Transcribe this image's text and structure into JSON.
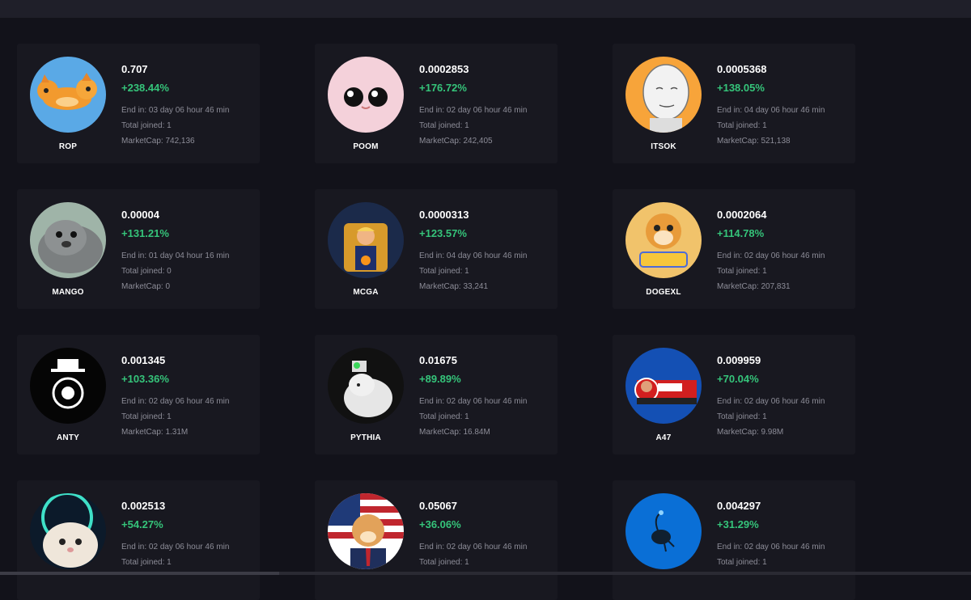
{
  "tokens": [
    {
      "ticker": "ROP",
      "price": "0.707",
      "change": "+238.44%",
      "end_in": "End in: 03 day 06 hour 46 min",
      "joined": "Total joined: 1",
      "marketcap": "MarketCap: 742,136",
      "icon": "orange-cat-icon"
    },
    {
      "ticker": "POOM",
      "price": "0.0002853",
      "change": "+176.72%",
      "end_in": "End in: 02 day 06 hour 46 min",
      "joined": "Total joined: 1",
      "marketcap": "MarketCap: 242,405",
      "icon": "pink-face-icon"
    },
    {
      "ticker": "ITSOK",
      "price": "0.0005368",
      "change": "+138.05%",
      "end_in": "End in: 04 day 06 hour 46 min",
      "joined": "Total joined: 1",
      "marketcap": "MarketCap: 521,138",
      "icon": "wojak-face-icon"
    },
    {
      "ticker": "MANGO",
      "price": "0.00004",
      "change": "+131.21%",
      "end_in": "End in: 01 day 04 hour 16 min",
      "joined": "Total joined: 0",
      "marketcap": "MarketCap: 0",
      "icon": "seal-icon"
    },
    {
      "ticker": "MCGA",
      "price": "0.0000313",
      "change": "+123.57%",
      "end_in": "End in: 04 day 06 hour 46 min",
      "joined": "Total joined: 1",
      "marketcap": "MarketCap: 33,241",
      "icon": "throne-man-icon"
    },
    {
      "ticker": "DOGEXL",
      "price": "0.0002064",
      "change": "+114.78%",
      "end_in": "End in: 02 day 06 hour 46 min",
      "joined": "Total joined: 1",
      "marketcap": "MarketCap: 207,831",
      "icon": "doge-xl-icon"
    },
    {
      "ticker": "ANTY",
      "price": "0.001345",
      "change": "+103.36%",
      "end_in": "End in: 02 day 06 hour 46 min",
      "joined": "Total joined: 1",
      "marketcap": "MarketCap: 1.31M",
      "icon": "spy-money-icon"
    },
    {
      "ticker": "PYTHIA",
      "price": "0.01675",
      "change": "+89.89%",
      "end_in": "End in: 02 day 06 hour 46 min",
      "joined": "Total joined: 1",
      "marketcap": "MarketCap: 16.84M",
      "icon": "rat-icon"
    },
    {
      "ticker": "A47",
      "price": "0.009959",
      "change": "+70.04%",
      "end_in": "End in: 02 day 06 hour 46 min",
      "joined": "Total joined: 1",
      "marketcap": "MarketCap: 9.98M",
      "icon": "a47-news-icon"
    },
    {
      "ticker": "",
      "price": "0.002513",
      "change": "+54.27%",
      "end_in": "End in: 02 day 06 hour 46 min",
      "joined": "Total joined: 1",
      "marketcap": "",
      "icon": "white-cat-icon"
    },
    {
      "ticker": "",
      "price": "0.05067",
      "change": "+36.06%",
      "end_in": "End in: 02 day 06 hour 46 min",
      "joined": "Total joined: 1",
      "marketcap": "",
      "icon": "usa-doge-icon"
    },
    {
      "ticker": "",
      "price": "0.004297",
      "change": "+31.29%",
      "end_in": "End in: 02 day 06 hour 46 min",
      "joined": "Total joined: 1",
      "marketcap": "",
      "icon": "deep-sea-fish-icon"
    }
  ],
  "colors": {
    "background": "#12121a",
    "card": "#181820",
    "positive": "#35c47a",
    "muted": "#8d8d98"
  }
}
